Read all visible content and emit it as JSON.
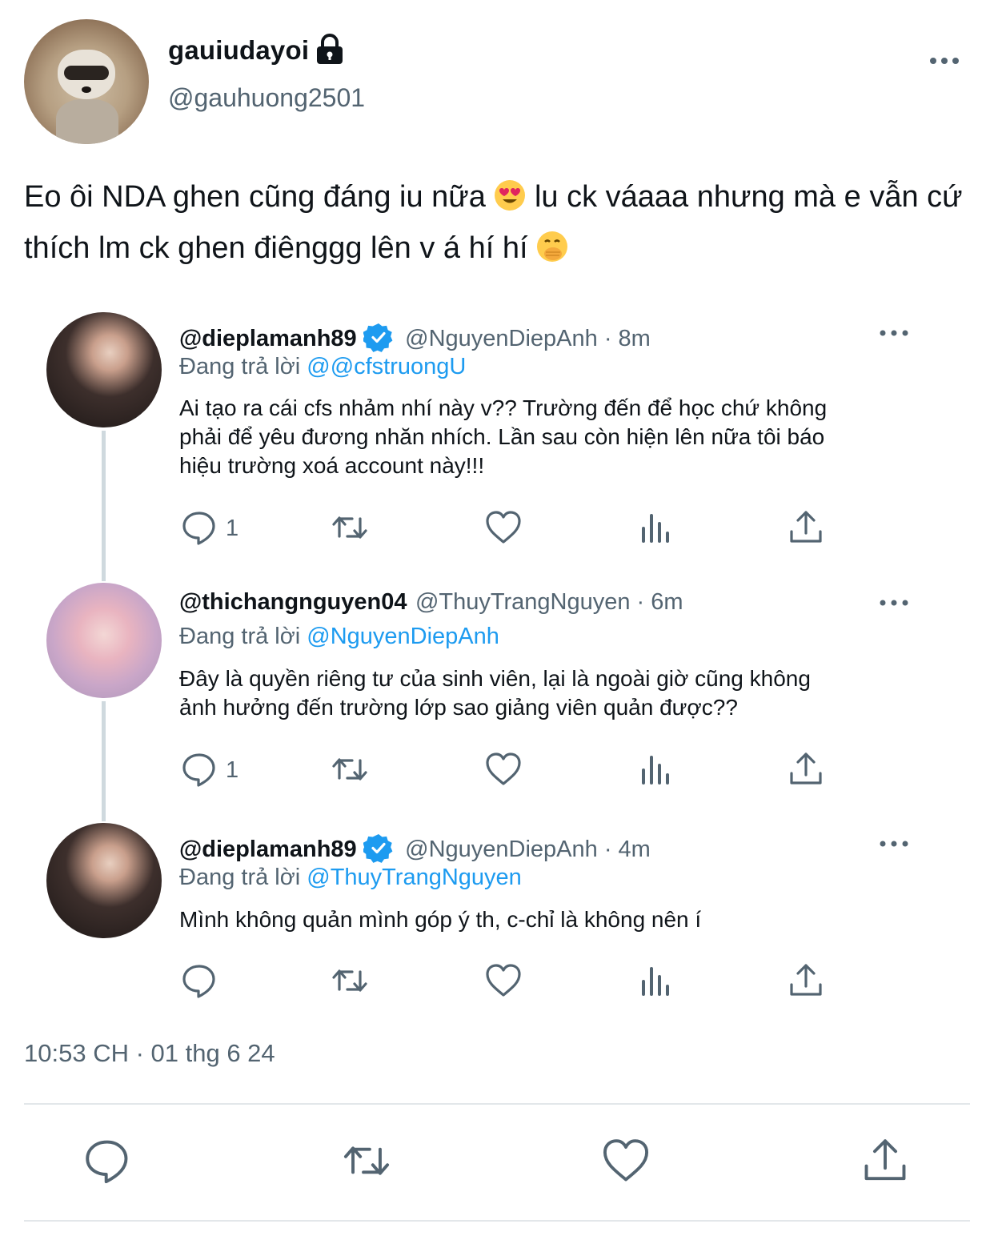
{
  "author": {
    "display_name": "gauiudayoi",
    "handle": "@gauhuong2501",
    "avatar_icon": "raccoon-avatar",
    "protected_icon": "lock-icon"
  },
  "tweet": {
    "text_part1": "Eo ôi NDA ghen cũng đáng iu nữa ",
    "emoji1": "heart-eyes-emoji",
    "text_part2": " lu ck váaaa nhưng mà e vẫn cứ thích lm ck ghen điênggg lên v á hí hí ",
    "emoji2": "face-with-hand-over-mouth-emoji",
    "timestamp": "10:53 CH · 01 thg 6 24"
  },
  "replies": [
    {
      "name": "@dieplamanh89",
      "verified": true,
      "meta": "@NguyenDiepAnh · 8m",
      "replying_label": "Đang trả lời ",
      "replying_to": "@@cfstruongU",
      "line1": "Ai tạo ra cái cfs nhảm nhí này v?? Trường đến để học chứ không",
      "line2": "phải để yêu đương nhăn nhích. Lần sau còn hiện lên nữa tôi báo",
      "line3": "hiệu trường xoá account này!!!",
      "reply_count": "1"
    },
    {
      "name": "@thichangnguyen04",
      "verified": false,
      "meta": "@ThuyTrangNguyen · 6m",
      "replying_label": "Đang trả lời ",
      "replying_to": "@NguyenDiepAnh",
      "line1": "Đây là quyền riêng tư của sinh viên, lại là ngoài giờ cũng không",
      "line2": "ảnh hưởng đến trường lớp sao giảng viên quản được??",
      "line3": "",
      "reply_count": "1"
    },
    {
      "name": "@dieplamanh89",
      "verified": true,
      "meta": "@NguyenDiepAnh · 4m",
      "replying_label": "Đang trả lời ",
      "replying_to": "@ThuyTrangNguyen",
      "line1": "Mình không quản mình góp ý th, c-chỉ là không nên í",
      "line2": "",
      "line3": "",
      "reply_count": ""
    }
  ],
  "colors": {
    "accent": "#1d9bf0",
    "muted": "#536471",
    "text": "#0f1419",
    "divider": "#e3e7ea"
  }
}
